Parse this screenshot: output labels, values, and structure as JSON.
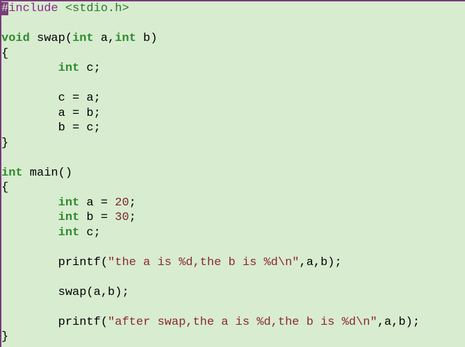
{
  "code": {
    "line1_hash": "#",
    "line1_include": "include ",
    "line1_hdr": "<stdio.h>",
    "line3_void": "void",
    "line3_fn": " swap(",
    "line3_int1": "int",
    "line3_a": " a,",
    "line3_int2": "int",
    "line3_b": " b)",
    "line4_open": "{",
    "line5_int": "int",
    "line5_c": " c;",
    "line7": "c = a;",
    "line8": "a = b;",
    "line9": "b = c;",
    "line10_close": "}",
    "line12_int": "int",
    "line12_main": " main()",
    "line13_open": "{",
    "line14_int": "int",
    "line14_a": " a = ",
    "line14_num": "20",
    "line14_semi": ";",
    "line15_int": "int",
    "line15_b": " b = ",
    "line15_num": "30",
    "line15_semi": ";",
    "line16_int": "int",
    "line16_c": " c;",
    "line18_p1": "printf(",
    "line18_str": "\"the a is %d,the b is %d\\n\"",
    "line18_p2": ",a,b);",
    "line20": "swap(a,b);",
    "line22_p1": "printf(",
    "line22_str": "\"after swap,the a is %d,the b is %d\\n\"",
    "line22_p2": ",a,b);",
    "line23_close": "}"
  }
}
